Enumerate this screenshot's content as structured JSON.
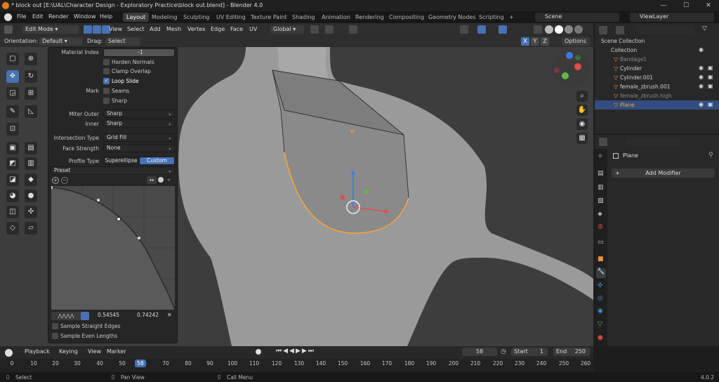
{
  "window": {
    "title": "* block out [E:\\UAL\\Character Design - Exploratory Practice\\block out.blend] - Blender 4.0",
    "minimize": "—",
    "maximize": "☐",
    "close": "✕"
  },
  "menu": [
    "File",
    "Edit",
    "Render",
    "Window",
    "Help"
  ],
  "workspaces": [
    "Layout",
    "Modeling",
    "Sculpting",
    "UV Editing",
    "Texture Paint",
    "Shading",
    "Animation",
    "Rendering",
    "Compositing",
    "Geometry Nodes",
    "Scripting",
    "+"
  ],
  "active_workspace": "Layout",
  "scene": "Scene",
  "view_layer": "ViewLayer",
  "viewport_header": {
    "mode": "Edit Mode",
    "menus": [
      "View",
      "Select",
      "Add",
      "Mesh",
      "Vertex",
      "Edge",
      "Face",
      "UV"
    ],
    "transform_orientation": "Global",
    "orientation_label": "Orientation:",
    "orientation_value": "Default",
    "drag_label": "Drag:",
    "drag_value": "Select Box",
    "axes": [
      "X",
      "Y",
      "Z"
    ],
    "options": "Options"
  },
  "operator_panel": {
    "material_index_label": "Material Index",
    "material_index_value": "-1",
    "harden_normals": "Harden Normals",
    "clamp_overlap": "Clamp Overlap",
    "loop_slide": "Loop Slide",
    "mark_label": "Mark",
    "seams": "Seams",
    "sharp": "Sharp",
    "miter_outer_label": "Miter Outer",
    "miter_outer_value": "Sharp",
    "inner_label": "Inner",
    "inner_value": "Sharp",
    "intersection_type_label": "Intersection Type",
    "intersection_type_value": "Grid Fill",
    "face_strength_label": "Face Strength",
    "face_strength_value": "None",
    "profile_type_label": "Profile Type",
    "profile_superellipse": "Superellipse",
    "profile_custom": "Custom",
    "preset": "Preset",
    "point_x": "0.54545",
    "point_y": "0.74242",
    "sample_straight_edges": "Sample Straight Edges",
    "sample_even_lengths": "Sample Even Lengths"
  },
  "outliner": {
    "header": "Scene Collection",
    "collection": "Collection",
    "items": [
      "Bandage1",
      "Cylinder",
      "Cylinder.001",
      "female_zbrush.001",
      "female_zbrush.high",
      "Plane"
    ]
  },
  "properties": {
    "object_name": "Plane",
    "add_modifier": "Add Modifier"
  },
  "timeline": {
    "menus": [
      "Playback",
      "Keying",
      "View",
      "Marker"
    ],
    "current_frame": "58",
    "start_label": "Start",
    "start_value": "1",
    "end_label": "End",
    "end_value": "250",
    "ticks": [
      "0",
      "10",
      "20",
      "30",
      "40",
      "50",
      "58",
      "70",
      "80",
      "90",
      "100",
      "110",
      "120",
      "130",
      "140",
      "150",
      "160",
      "170",
      "180",
      "190",
      "200",
      "210",
      "220",
      "230",
      "240",
      "250",
      "260"
    ]
  },
  "status": {
    "select": "Select",
    "pan_view": "Pan View",
    "call_menu": "Call Menu",
    "version": "4.0.2"
  },
  "colors": {
    "accent": "#4772b3",
    "selection": "#f5a53c",
    "background": "#3d3d3d"
  }
}
